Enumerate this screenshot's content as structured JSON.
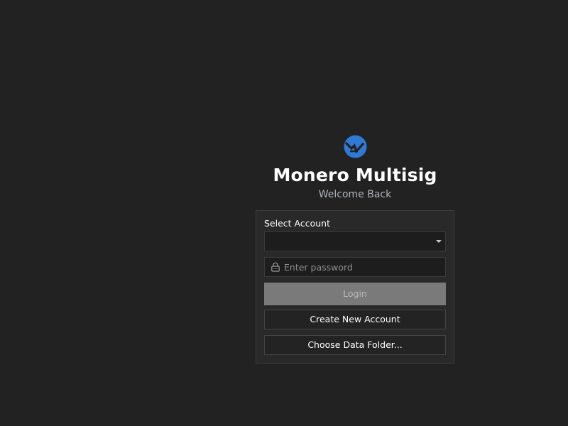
{
  "app": {
    "title": "Monero Multisig",
    "subtitle": "Welcome Back",
    "logo_icon": "monero-logo-icon",
    "accent_color": "#2f7ad6"
  },
  "login_form": {
    "select_account_label": "Select Account",
    "selected_account": "",
    "password_placeholder": "Enter password",
    "password_value": "",
    "lock_icon": "lock-icon",
    "login_label": "Login",
    "login_enabled": false,
    "create_account_label": "Create New Account",
    "choose_folder_label": "Choose Data Folder..."
  }
}
